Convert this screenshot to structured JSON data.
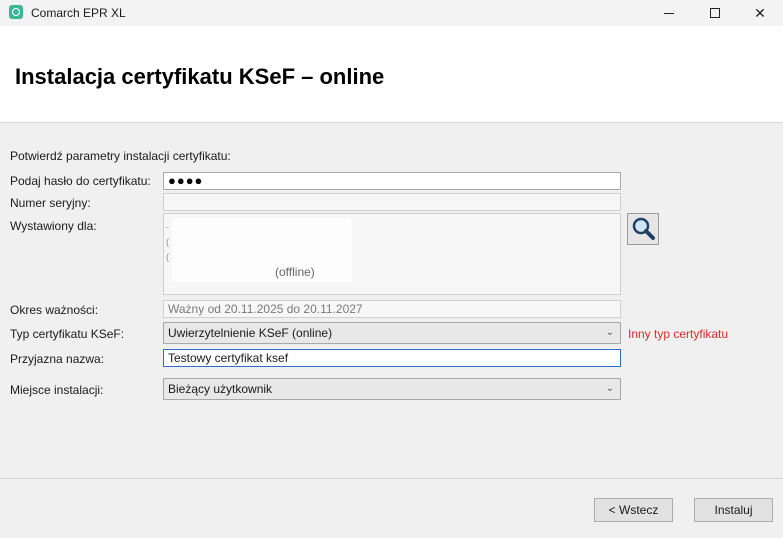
{
  "window": {
    "title": "Comarch EPR XL"
  },
  "header": {
    "title": "Instalacja certyfikatu KSeF – online"
  },
  "form": {
    "intro": "Potwierdź parametry instalacji certyfikatu:",
    "password": {
      "label": "Podaj hasło do certyfikatu:",
      "value": "●●●●"
    },
    "serial": {
      "label": "Numer seryjny:",
      "value": ""
    },
    "issued_for": {
      "label": "Wystawiony dla:",
      "visible_text": "(offline)"
    },
    "validity": {
      "label": "Okres ważności:",
      "value": "Ważny od 20.11.2025 do 20.11.2027"
    },
    "cert_type": {
      "label": "Typ certyfikatu KSeF:",
      "selected": "Uwierzytelnienie KSeF (online)",
      "alt_link": "Inny typ certyfikatu"
    },
    "friendly_name": {
      "label": "Przyjazna nazwa:",
      "value": "Testowy certyfikat ksef"
    },
    "install_location": {
      "label": "Miejsce instalacji:",
      "selected": "Bieżący użytkownik"
    }
  },
  "footer": {
    "back_label": "< Wstecz",
    "install_label": "Instaluj"
  },
  "colors": {
    "accent_link": "#e02a2a",
    "focus_border": "#2a6fc9"
  },
  "icons": {
    "search": "magnifier-icon"
  }
}
